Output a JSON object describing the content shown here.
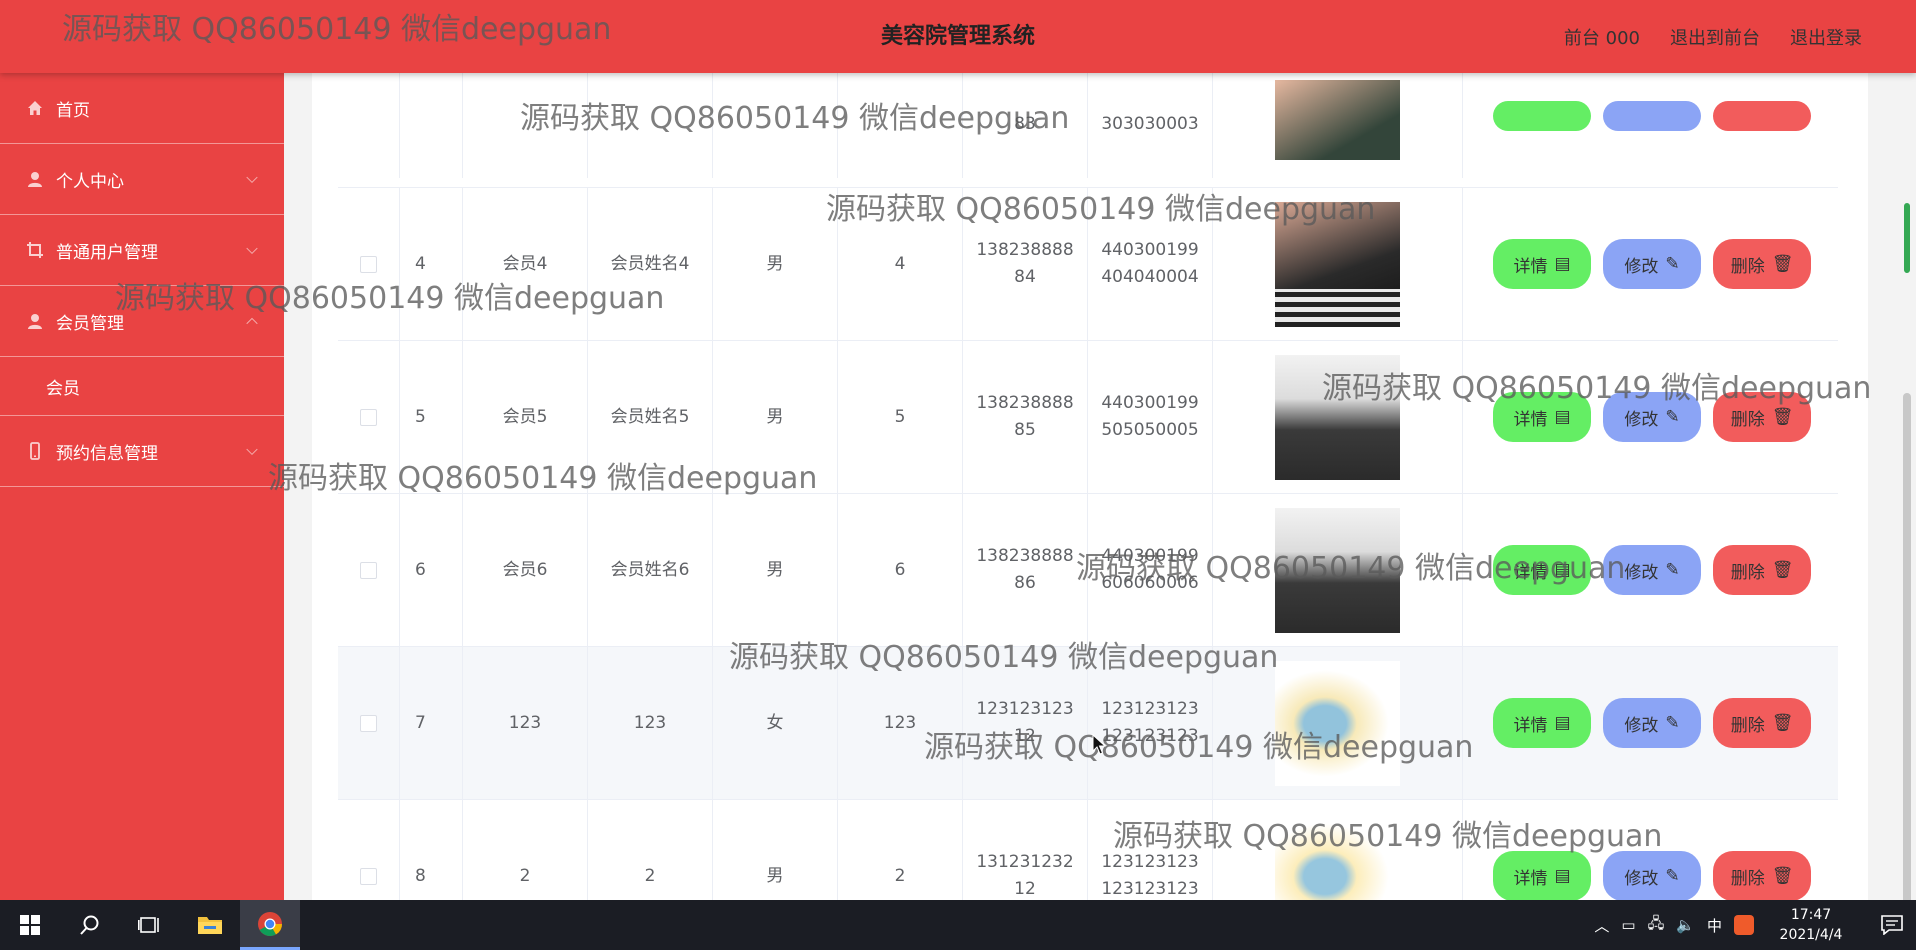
{
  "header": {
    "title": "美容院管理系统",
    "user": "前台 000",
    "back_front": "退出到前台",
    "logout": "退出登录"
  },
  "sidebar": {
    "items": [
      {
        "label": "首页",
        "icon": "home-icon"
      },
      {
        "label": "个人中心",
        "icon": "user-icon"
      },
      {
        "label": "普通用户管理",
        "icon": "crop-icon"
      },
      {
        "label": "会员管理",
        "icon": "user-icon"
      },
      {
        "label": "预约信息管理",
        "icon": "phone-icon"
      }
    ],
    "sub_items": [
      {
        "label": "会员"
      }
    ]
  },
  "table": {
    "partial_top": {
      "phone_end": "83",
      "id_end": "303030003"
    },
    "rows": [
      {
        "index": "4",
        "account": "会员4",
        "name": "会员姓名4",
        "gender": "男",
        "age": "4",
        "phone_1": "138238888",
        "phone_2": "84",
        "id_1": "440300199",
        "id_2": "404040004"
      },
      {
        "index": "5",
        "account": "会员5",
        "name": "会员姓名5",
        "gender": "男",
        "age": "5",
        "phone_1": "138238888",
        "phone_2": "85",
        "id_1": "440300199",
        "id_2": "505050005"
      },
      {
        "index": "6",
        "account": "会员6",
        "name": "会员姓名6",
        "gender": "男",
        "age": "6",
        "phone_1": "138238888",
        "phone_2": "86",
        "id_1": "440300199",
        "id_2": "606060006"
      },
      {
        "index": "7",
        "account": "123",
        "name": "123",
        "gender": "女",
        "age": "123",
        "phone_1": "123123123",
        "phone_2": "12",
        "id_1": "123123123",
        "id_2": "123123123"
      },
      {
        "index": "8",
        "account": "2",
        "name": "2",
        "gender": "男",
        "age": "2",
        "phone_1": "131231232",
        "phone_2": "12",
        "id_1": "123123123",
        "id_2": "123123123"
      }
    ],
    "actions": {
      "detail": "详情",
      "edit": "修改",
      "delete": "删除"
    }
  },
  "taskbar": {
    "time": "17:47",
    "date": "2021/4/4",
    "ime": "中"
  },
  "watermark": "源码获取 QQ86050149 微信deepguan",
  "colors": {
    "primary": "#e94343",
    "detail": "#64ee64",
    "edit": "#8ba4f5",
    "delete": "#f25c5c"
  }
}
